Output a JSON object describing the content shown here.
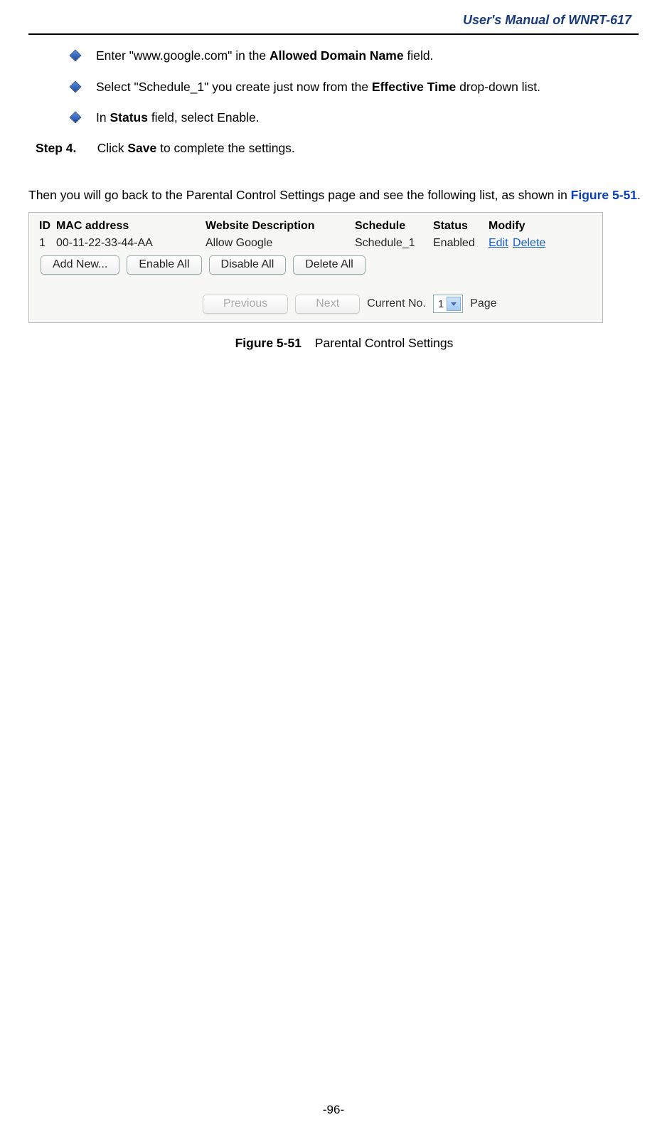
{
  "header": {
    "title": "User's  Manual  of  WNRT-617"
  },
  "bullets": [
    {
      "pre": "Enter \"www.google.com\" in the ",
      "bold": "Allowed Domain Name",
      "post": " field."
    },
    {
      "pre": "Select \"Schedule_1\" you create just now from the ",
      "bold": "Effective Time",
      "post": " drop-down list."
    },
    {
      "pre": "In ",
      "bold": "Status",
      "post": " field, select Enable."
    }
  ],
  "step": {
    "label": "Step 4.",
    "pre": "Click ",
    "bold": "Save",
    "post": " to complete the settings."
  },
  "para": {
    "pre": "Then you will go back to the Parental Control Settings page and see the following list, as shown in ",
    "figref": "Figure 5-51",
    "post": "."
  },
  "screenshot": {
    "headers": {
      "id": "ID",
      "mac": "MAC address",
      "desc": "Website Description",
      "sched": "Schedule",
      "status": "Status",
      "modify": "Modify"
    },
    "row": {
      "id": "1",
      "mac": "00-11-22-33-44-AA",
      "desc": "Allow Google",
      "sched": "Schedule_1",
      "status": "Enabled",
      "edit": "Edit",
      "delete": "Delete"
    },
    "buttons": {
      "addnew": "Add New...",
      "enableall": "Enable All",
      "disableall": "Disable All",
      "deleteall": "Delete All",
      "previous": "Previous",
      "next": "Next"
    },
    "pager": {
      "currentno": "Current No.",
      "value": "1",
      "page": "Page"
    }
  },
  "figcaption": {
    "num": "Figure 5-51",
    "text": "Parental Control Settings"
  },
  "footer": {
    "page": "-96-"
  }
}
